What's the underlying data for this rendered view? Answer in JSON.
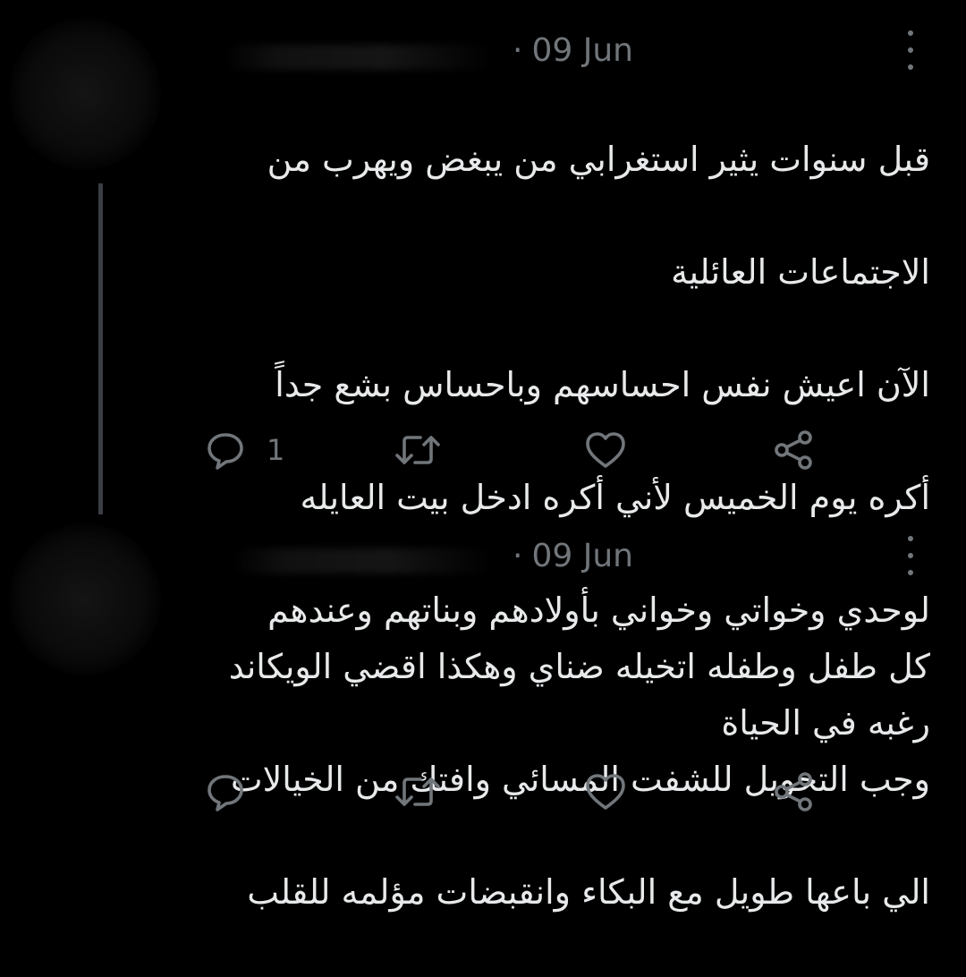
{
  "colors": {
    "background": "#000000",
    "text": "#e7e9ea",
    "muted": "#71767b",
    "thread_line": "#3a3d41"
  },
  "tweets": [
    {
      "separator": "·",
      "date": "09 Jun",
      "lines": [
        "قبل سنوات يثير استغرابي من يبغض ويهرب من",
        "الاجتماعات العائلية",
        "الآن اعيش نفس احساسهم وباحساس بشع جداً",
        "أكره يوم الخميس لأني أكره ادخل بيت العايله",
        "لوحدي وخواتي وخواني بأولادهم وبناتهم وعندهم",
        "رغبه في الحياة"
      ],
      "reply_count": "1",
      "icons": [
        "reply-icon",
        "retweet-icon",
        "like-icon",
        "share-icon"
      ]
    },
    {
      "separator": "·",
      "date": "09 Jun",
      "lines": [
        "كل طفل وطفله اتخيله ضناي وهكذا اقضي الويكاند",
        "وجب التحويل للشفت المسائي وافتك من الخيالات",
        "الي باعها طويل مع البكاء وانقبضات مؤلمه للقلب"
      ],
      "reply_count": "",
      "icons": [
        "reply-icon",
        "retweet-icon",
        "like-icon",
        "share-icon"
      ]
    }
  ]
}
